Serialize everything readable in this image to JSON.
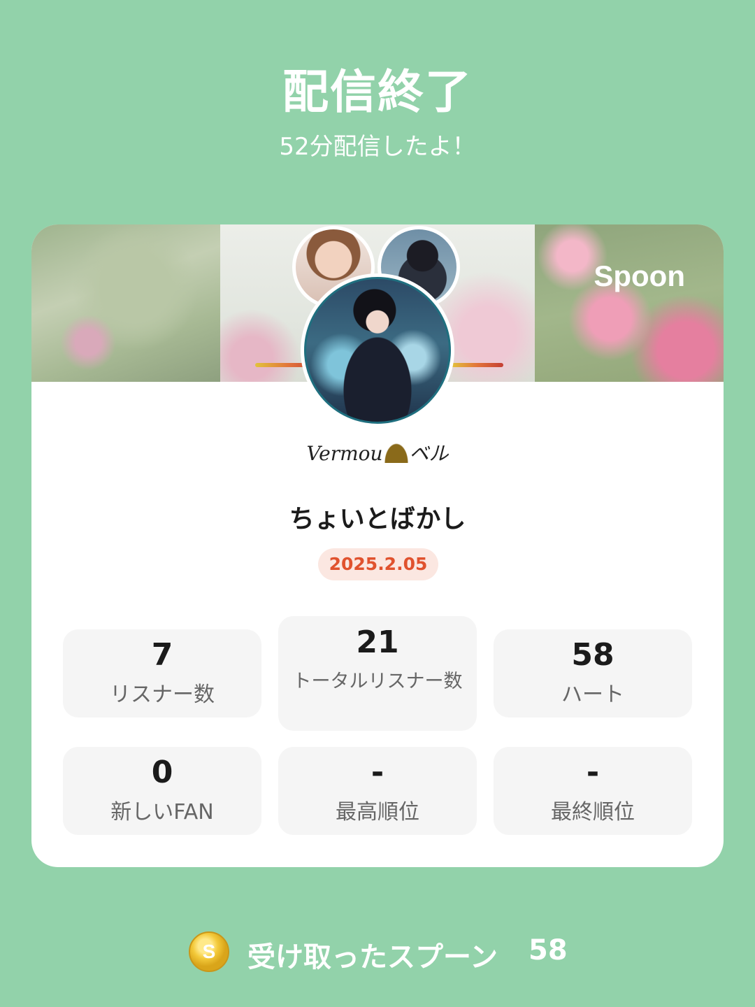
{
  "header": {
    "title": "配信終了",
    "subtitle": "52分配信したよ！"
  },
  "card": {
    "brand": "Spoon",
    "signature_text": "Vermou",
    "signature_suffix": "ベル",
    "broadcast_title": "ちょいとばかし",
    "date": "2025.2.05"
  },
  "stats": [
    {
      "value": "7",
      "label": "リスナー数"
    },
    {
      "value": "21",
      "label": "トータルリスナー数"
    },
    {
      "value": "58",
      "label": "ハート"
    },
    {
      "value": "0",
      "label": "新しいFAN"
    },
    {
      "value": "-",
      "label": "最高順位"
    },
    {
      "value": "-",
      "label": "最終順位"
    }
  ],
  "footer": {
    "coin_symbol": "S",
    "label": "受け取ったスプーン",
    "value": "58"
  },
  "colors": {
    "background": "#92d2aa",
    "date_text": "#e0522e",
    "date_bg": "#fbe7e1"
  }
}
